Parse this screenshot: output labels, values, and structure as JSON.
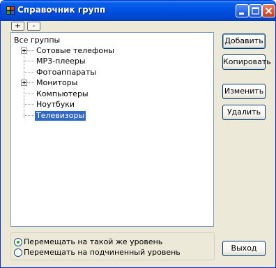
{
  "window": {
    "title": "Справочник групп",
    "controls": [
      "minimize-icon",
      "maximize-icon",
      "close-icon"
    ]
  },
  "toolbar": {
    "expand_label": "+",
    "collapse_label": "-"
  },
  "tree": {
    "root_label": "Все группы",
    "items": [
      {
        "label": "Сотовые телефоны",
        "has_children": true,
        "selected": false
      },
      {
        "label": "MP3-плееры",
        "has_children": false,
        "selected": false
      },
      {
        "label": "Фотоаппараты",
        "has_children": false,
        "selected": false
      },
      {
        "label": "Мониторы",
        "has_children": true,
        "selected": false
      },
      {
        "label": "Компьютеры",
        "has_children": false,
        "selected": false
      },
      {
        "label": "Ноутбуки",
        "has_children": false,
        "selected": false
      },
      {
        "label": "Телевизоры",
        "has_children": false,
        "selected": true
      }
    ]
  },
  "buttons": {
    "add": "Добавить",
    "copy": "Копировать",
    "edit": "Изменить",
    "delete": "Удалить",
    "exit": "Выход"
  },
  "move_options": [
    {
      "label": "Перемещать на такой же уровень",
      "checked": true
    },
    {
      "label": "Перемещать на подчиненный уровень",
      "checked": false
    }
  ],
  "colors": {
    "titlebar": "#0054e3",
    "window_bg": "#ece9d8",
    "selection": "#316ac5"
  }
}
